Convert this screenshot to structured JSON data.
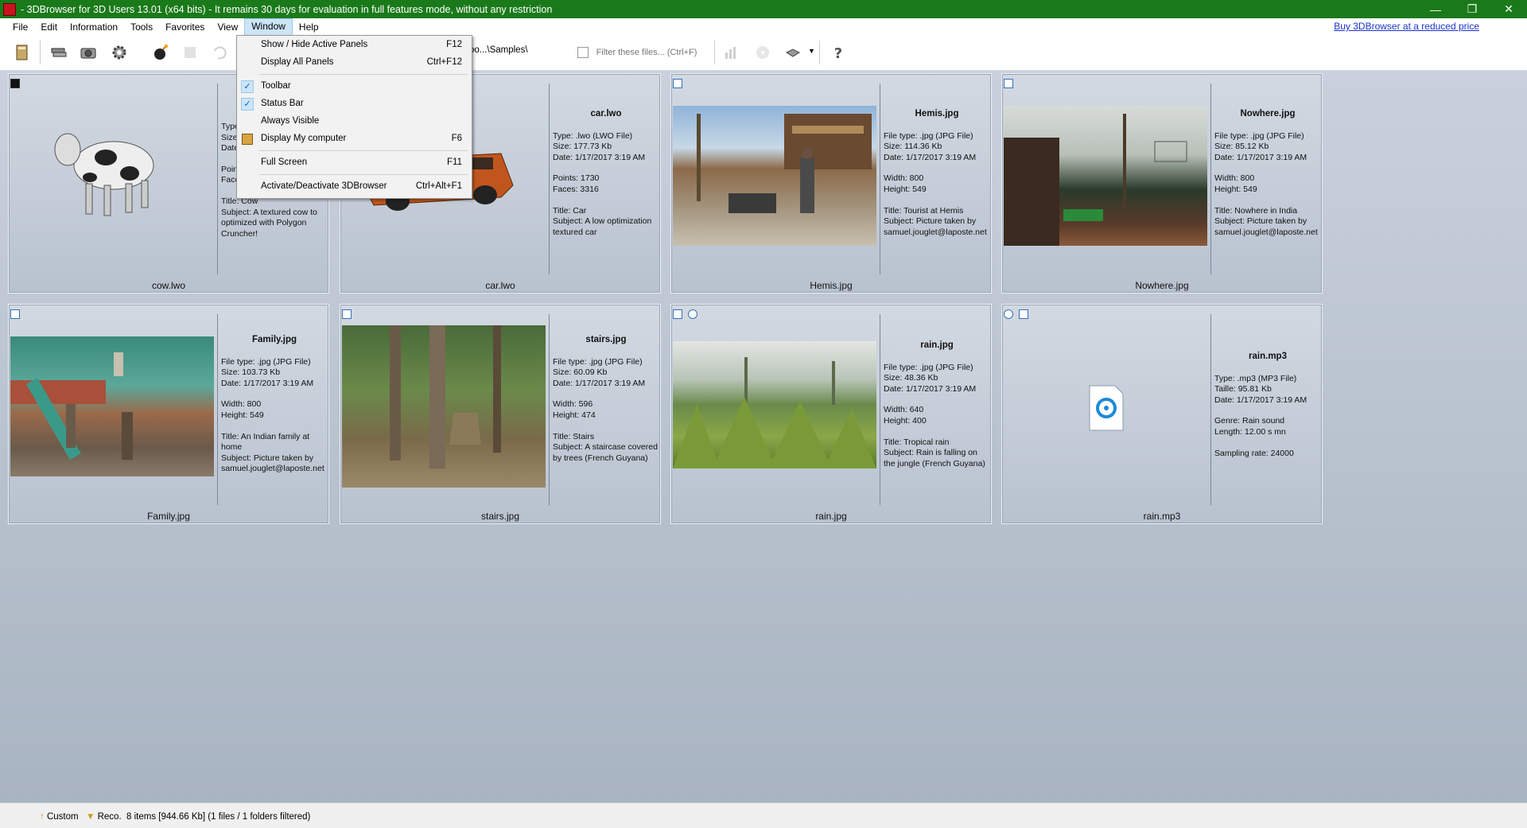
{
  "window": {
    "title": "- 3DBrowser for 3D Users 13.01 (x64 bits) - It remains 30 days for evaluation in full features mode, without any restriction",
    "minimize": "—",
    "restore": "❐",
    "close": "✕"
  },
  "menu": {
    "items": [
      "File",
      "Edit",
      "Information",
      "Tools",
      "Favorites",
      "View",
      "Window",
      "Help"
    ],
    "active": "Window",
    "buy_link": "Buy 3DBrowser at a reduced price"
  },
  "toolbar": {
    "path": "oo...\\Samples\\",
    "filter_placeholder": "Filter these files... (Ctrl+F)",
    "icons": [
      "book-icon",
      "books-icon",
      "camera-icon",
      "gear-icon",
      "bomb-icon",
      "stack-icon",
      "undo-icon",
      "bar-chart-icon",
      "disc-icon",
      "hand-icon",
      "help-icon"
    ]
  },
  "window_menu": {
    "items": [
      {
        "label": "Show / Hide Active Panels",
        "shortcut": "F12"
      },
      {
        "label": "Display All Panels",
        "shortcut": "Ctrl+F12"
      },
      {
        "label": "Toolbar",
        "shortcut": "",
        "checked": true
      },
      {
        "label": "Status Bar",
        "shortcut": "",
        "checked": true
      },
      {
        "label": "Always Visible",
        "shortcut": ""
      },
      {
        "label": "Display My computer",
        "shortcut": "F6"
      },
      {
        "label": "Full Screen",
        "shortcut": "F11"
      },
      {
        "label": "Activate/Deactivate 3DBrowser",
        "shortcut": "Ctrl+Alt+F1"
      }
    ]
  },
  "cards": [
    {
      "caption": "cow.lwo",
      "info": {
        "l1": "Type",
        "l2": "Size",
        "l3": "Date",
        "l4": "Poin",
        "l5": "Face",
        "title": "Title: Cow",
        "subject": "Subject: A textured cow to optimized with Polygon Cruncher!"
      }
    },
    {
      "caption": "car.lwo",
      "info": {
        "fname": "car.lwo",
        "type": "Type: .lwo (LWO File)",
        "size": "Size: 177.73 Kb",
        "date": "Date: 1/17/2017 3:19 AM",
        "p1": "Points: 1730",
        "p2": "Faces: 3316",
        "title": "Title: Car",
        "subject": "Subject: A low optimization textured car"
      }
    },
    {
      "caption": "Hemis.jpg",
      "info": {
        "fname": "Hemis.jpg",
        "type": "File type: .jpg (JPG File)",
        "size": "Size: 114.36 Kb",
        "date": "Date: 1/17/2017 3:19 AM",
        "p1": "Width: 800",
        "p2": "Height: 549",
        "title": "Title: Tourist at Hemis",
        "subject": "Subject: Picture taken by samuel.jouglet@laposte.net"
      }
    },
    {
      "caption": "Nowhere.jpg",
      "info": {
        "fname": "Nowhere.jpg",
        "type": "File type: .jpg (JPG File)",
        "size": "Size: 85.12 Kb",
        "date": "Date: 1/17/2017 3:19 AM",
        "p1": "Width: 800",
        "p2": "Height: 549",
        "title": "Title: Nowhere in India",
        "subject": "Subject: Picture taken by samuel.jouglet@laposte.net"
      }
    },
    {
      "caption": "Family.jpg",
      "info": {
        "fname": "Family.jpg",
        "type": "File type: .jpg (JPG File)",
        "size": "Size: 103.73 Kb",
        "date": "Date: 1/17/2017 3:19 AM",
        "p1": "Width: 800",
        "p2": "Height: 549",
        "title": "Title: An Indian family at home",
        "subject": "Subject: Picture taken by samuel.jouglet@laposte.net"
      }
    },
    {
      "caption": "stairs.jpg",
      "info": {
        "fname": "stairs.jpg",
        "type": "File type: .jpg (JPG File)",
        "size": "Size: 60.09 Kb",
        "date": "Date: 1/17/2017 3:19 AM",
        "p1": "Width: 596",
        "p2": "Height: 474",
        "title": "Title: Stairs",
        "subject": "Subject: A staircase covered by trees (French Guyana)"
      }
    },
    {
      "caption": "rain.jpg",
      "info": {
        "fname": "rain.jpg",
        "type": "File type: .jpg (JPG File)",
        "size": "Size: 48.36 Kb",
        "date": "Date: 1/17/2017 3:19 AM",
        "p1": "Width: 640",
        "p2": "Height: 400",
        "title": "Title: Tropical rain",
        "subject": "Subject: Rain is falling on the jungle (French Guyana)"
      }
    },
    {
      "caption": "rain.mp3",
      "info": {
        "fname": "rain.mp3",
        "type": "Type: .mp3 (MP3 File)",
        "size": "Taille: 95.81 Kb",
        "date": "Date: 1/17/2017 3:19 AM",
        "p1": "Genre: Rain sound",
        "p2": "Length: 12.00 s mn",
        "title": "Sampling rate: 24000"
      }
    }
  ],
  "statusbar": {
    "custom": "Custom",
    "reco": "Reco.",
    "items": "8 items [944.66 Kb] (1 files / 1 folders filtered)"
  },
  "colors": {
    "titlebar": "#1a7a1a",
    "content_bg": "#b9c3cf",
    "menu_highlight": "#cce4f7"
  }
}
